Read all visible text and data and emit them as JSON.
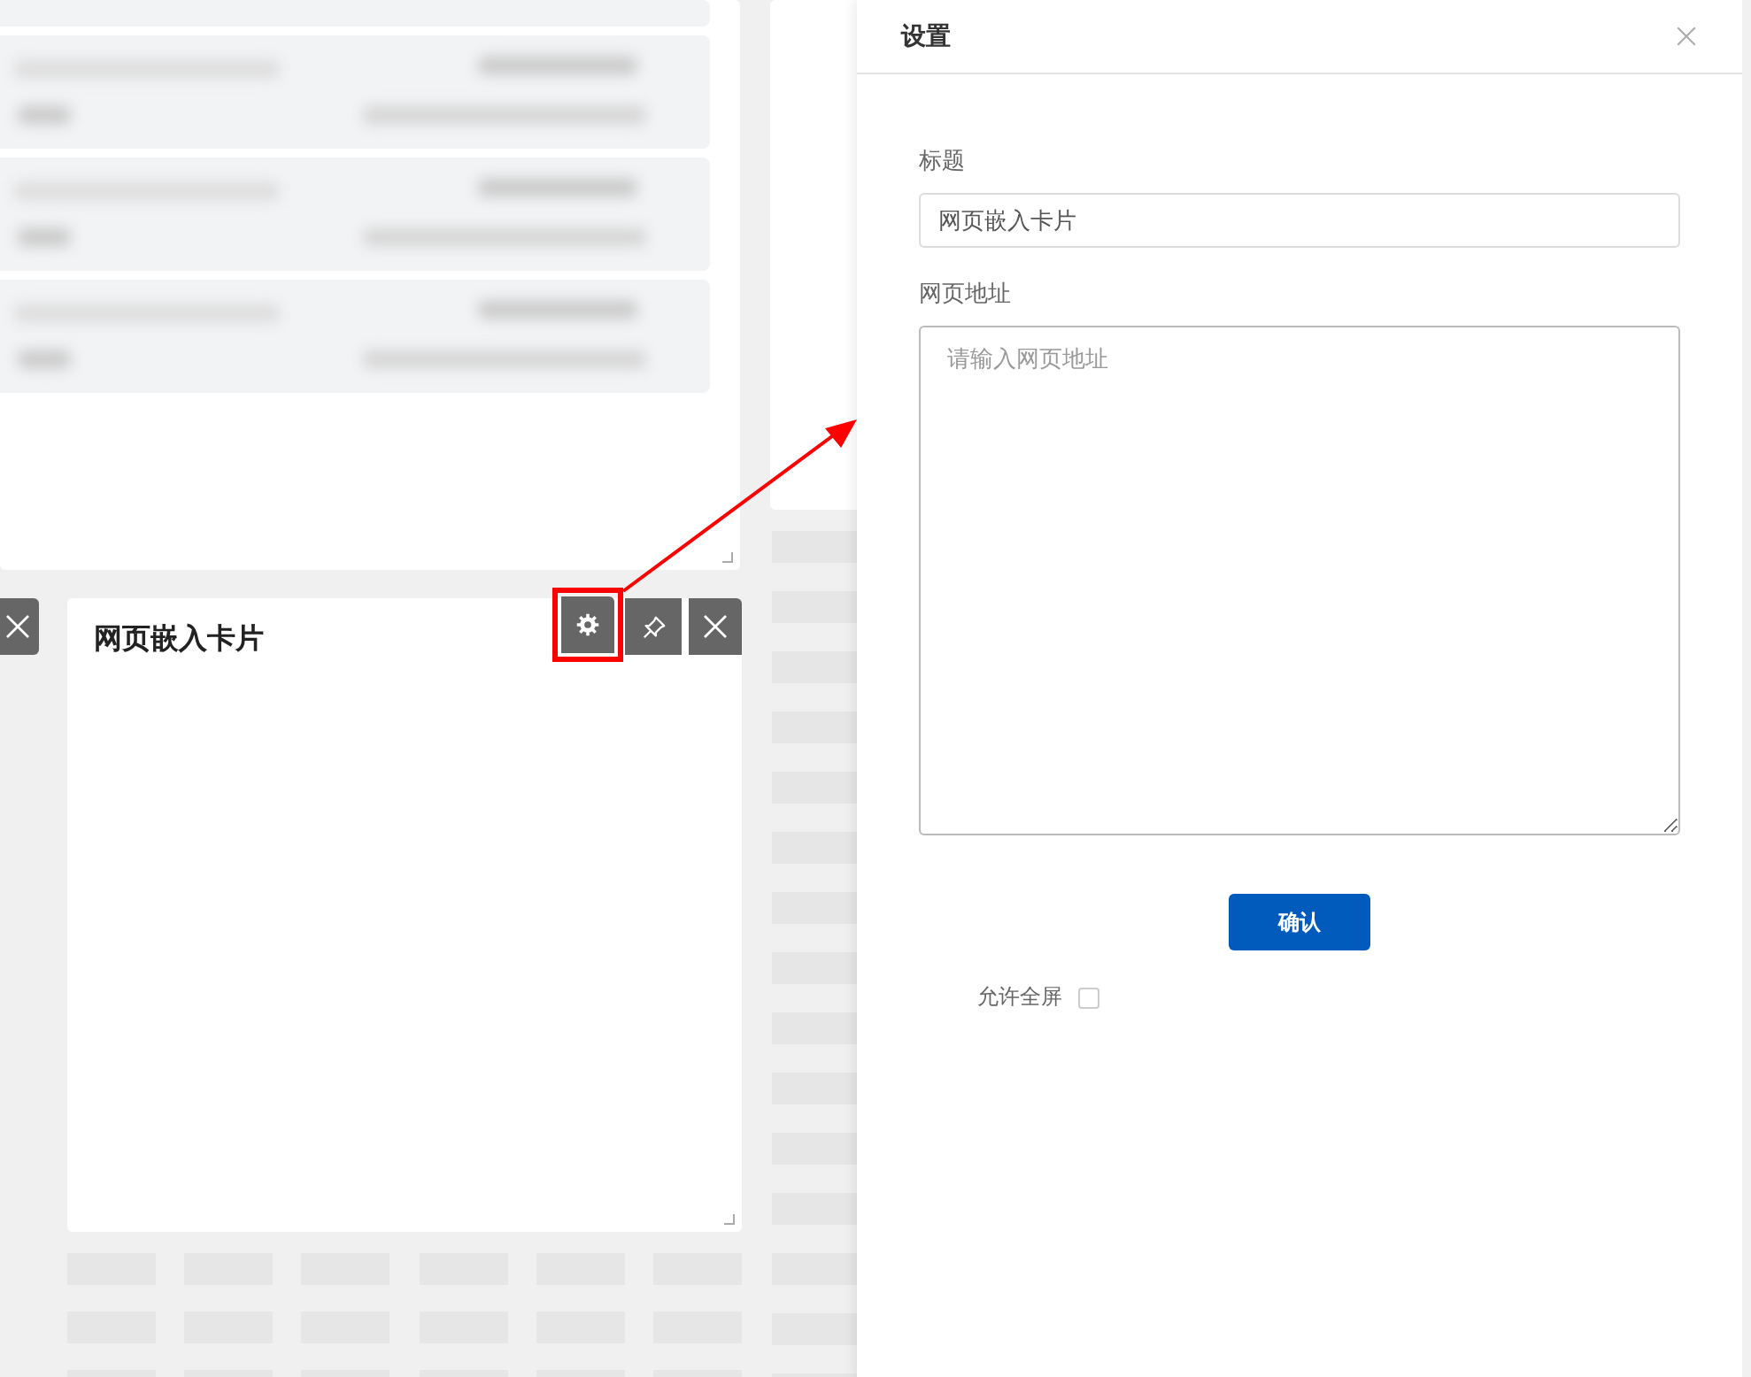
{
  "list_card": {
    "rows": [
      {
        "kind": "blurred"
      },
      {
        "kind": "blurred"
      },
      {
        "kind": "blurred"
      },
      {
        "kind": "blurred"
      }
    ]
  },
  "side_card": {
    "tools": [
      {
        "kind": "close",
        "highlighted": false
      }
    ]
  },
  "embed_card": {
    "title": "网页嵌入卡片",
    "tools": [
      {
        "kind": "settings",
        "highlighted": true
      },
      {
        "kind": "pin",
        "highlighted": false
      },
      {
        "kind": "close",
        "highlighted": false
      }
    ]
  },
  "drawer": {
    "title": "设置",
    "fields": [
      {
        "kind": "input",
        "label": "标题",
        "value": "网页嵌入卡片"
      },
      {
        "kind": "textarea",
        "label": "网页地址",
        "placeholder": "请输入网页地址"
      }
    ],
    "confirm_button": "确认",
    "fullscreen": {
      "label": "允许全屏",
      "checked": false
    }
  }
}
